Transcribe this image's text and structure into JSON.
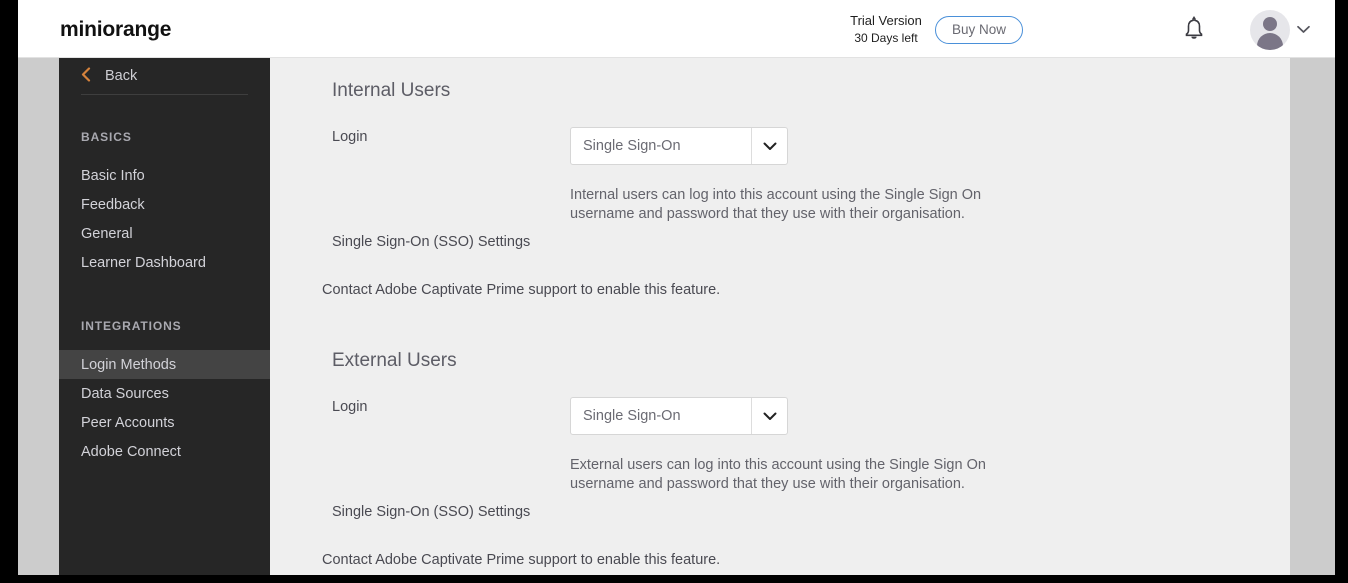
{
  "header": {
    "brand": "miniorange",
    "trial_title": "Trial Version",
    "trial_subtitle": "30 Days left",
    "buy_now_label": "Buy Now",
    "bell_icon": "bell-icon",
    "avatar_icon": "avatar-icon",
    "avatar_caret_icon": "chevron-down-icon"
  },
  "sidebar": {
    "back_label": "Back",
    "back_icon": "chevron-left-icon",
    "groups": [
      {
        "title": "BASICS",
        "items": [
          {
            "label": "Basic Info",
            "active": false
          },
          {
            "label": "Feedback",
            "active": false
          },
          {
            "label": "General",
            "active": false
          },
          {
            "label": "Learner Dashboard",
            "active": false
          }
        ]
      },
      {
        "title": "INTEGRATIONS",
        "items": [
          {
            "label": "Login Methods",
            "active": true
          },
          {
            "label": "Data Sources",
            "active": false
          },
          {
            "label": "Peer Accounts",
            "active": false
          },
          {
            "label": "Adobe Connect",
            "active": false
          }
        ]
      }
    ]
  },
  "main": {
    "internal": {
      "heading": "Internal Users",
      "login_label": "Login",
      "login_value": "Single Sign-On",
      "description": "Internal users can log into this account using the Single Sign On username and password that they use with their organisation.",
      "sso_settings_label": "Single Sign-On (SSO) Settings",
      "contact_note": "Contact Adobe Captivate Prime support to enable this feature."
    },
    "external": {
      "heading": "External Users",
      "login_label": "Login",
      "login_value": "Single Sign-On",
      "description": "External users can log into this account using the Single Sign On username and password that they use with their organisation.",
      "sso_settings_label": "Single Sign-On (SSO) Settings",
      "contact_note": "Contact Adobe Captivate Prime support to enable this feature."
    },
    "select_arrow_icon": "chevron-down-icon"
  },
  "colors": {
    "sidebar_bg": "#262626",
    "sidebar_active_bg": "#444444",
    "content_bg": "#efefef",
    "accent_orange": "#d4823c",
    "accent_blue": "#4a90d9"
  }
}
